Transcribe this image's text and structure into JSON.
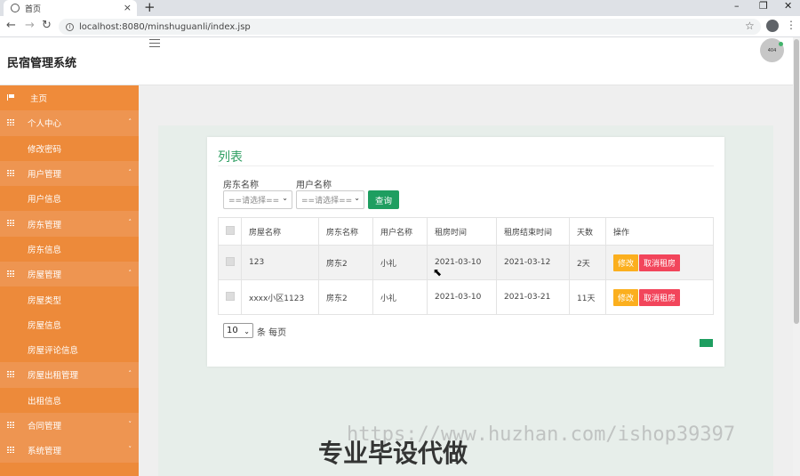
{
  "browser": {
    "tab_title": "首页",
    "url": "localhost:8080/minshuguanli/index.jsp",
    "new_tab": "+",
    "minimize": "–",
    "restore": "❐",
    "close": "✕"
  },
  "app": {
    "title": "民宿管理系统",
    "avatar_text": "404"
  },
  "sidebar": {
    "items": [
      {
        "label": "主页",
        "type": "home",
        "icon": "flag-icon"
      },
      {
        "label": "个人中心",
        "type": "group",
        "icon": "grid-icon"
      },
      {
        "label": "修改密码",
        "type": "sub"
      },
      {
        "label": "用户管理",
        "type": "group",
        "icon": "grid-icon"
      },
      {
        "label": "用户信息",
        "type": "sub"
      },
      {
        "label": "房东管理",
        "type": "group",
        "icon": "grid-icon"
      },
      {
        "label": "房东信息",
        "type": "sub"
      },
      {
        "label": "房屋管理",
        "type": "group",
        "icon": "grid-icon"
      },
      {
        "label": "房屋类型",
        "type": "sub"
      },
      {
        "label": "房屋信息",
        "type": "sub"
      },
      {
        "label": "房屋评论信息",
        "type": "sub"
      },
      {
        "label": "房屋出租管理",
        "type": "group",
        "icon": "grid-icon"
      },
      {
        "label": "出租信息",
        "type": "sub"
      },
      {
        "label": "合同管理",
        "type": "group",
        "icon": "grid-icon",
        "collapsed": true
      },
      {
        "label": "系统管理",
        "type": "group",
        "icon": "grid-icon",
        "collapsed": true
      }
    ]
  },
  "list": {
    "title": "列表",
    "filters": {
      "landlord_label": "房东名称",
      "landlord_value": "==请选择==",
      "user_label": "用户名称",
      "user_value": "==请选择==",
      "query_button": "查询"
    },
    "columns": [
      "",
      "房屋名称",
      "房东名称",
      "用户名称",
      "租房时间",
      "租房结束时间",
      "天数",
      "操作"
    ],
    "rows": [
      {
        "house": "123",
        "landlord": "房东2",
        "user": "小礼",
        "start": "2021-03-10",
        "end": "2021-03-12",
        "days": "2天",
        "edit": "修改",
        "cancel": "取消租房"
      },
      {
        "house": "xxxx小区1123",
        "landlord": "房东2",
        "user": "小礼",
        "start": "2021-03-10",
        "end": "2021-03-21",
        "days": "11天",
        "edit": "修改",
        "cancel": "取消租房"
      }
    ],
    "pager": {
      "page_size": "10",
      "page_size_label": "条 每页"
    }
  },
  "watermark": {
    "url_text": "https://www.huzhan.com/ishop39397",
    "caption": "专业毕设代做"
  },
  "colors": {
    "sidebar": "#ed8a3a",
    "accent_green": "#1e9e60",
    "edit_button": "#fbaf1e",
    "cancel_button": "#f2455b"
  }
}
